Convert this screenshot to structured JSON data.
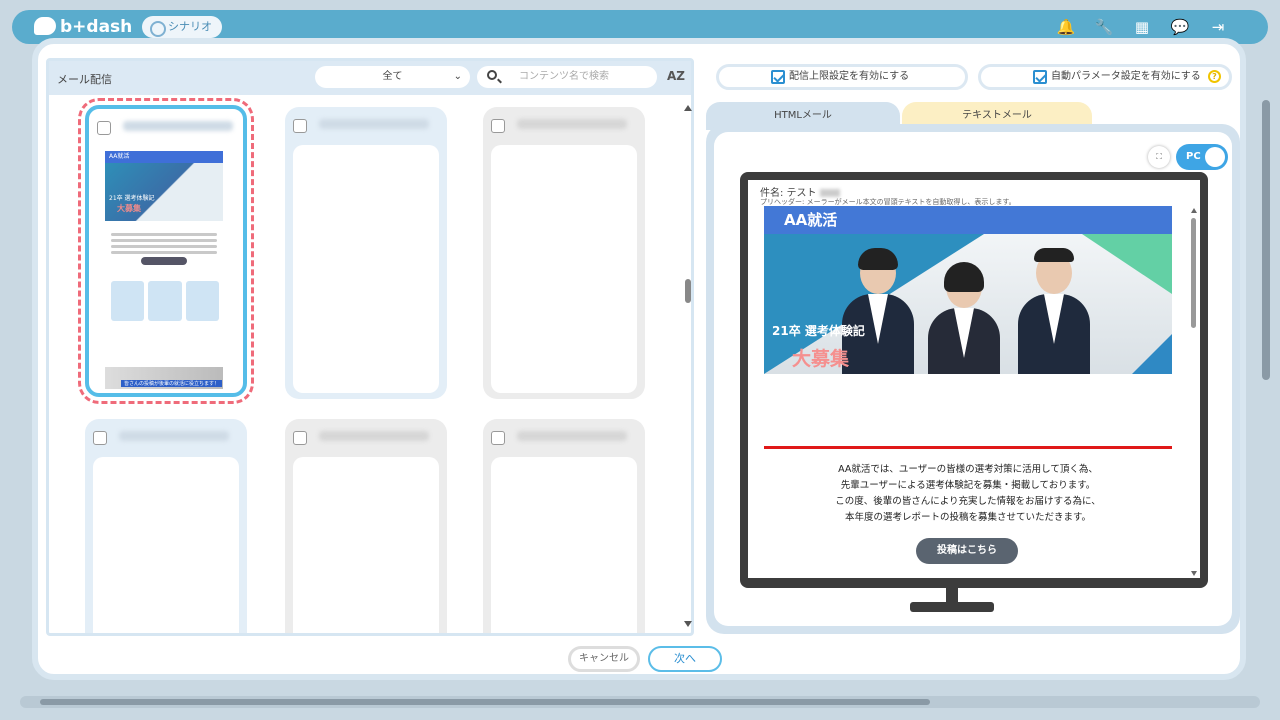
{
  "app": {
    "logo": "b+dash",
    "scenario_chip": "シナリオ",
    "header_icons": [
      "bell-icon",
      "wrench-icon",
      "grid-icon",
      "chat-icon",
      "logout-icon"
    ]
  },
  "left": {
    "title": "メール配信",
    "filter": {
      "selected": "全て"
    },
    "search": {
      "placeholder": "コンテンツ名で検索"
    },
    "sort_label": "AZ"
  },
  "thumb": {
    "header": "AA就活",
    "hero_line1": "21卒 選考体験記",
    "hero_line2": "大募集",
    "banner": "皆さんの投稿が後輩の就活に役立ちます！"
  },
  "options": {
    "limit_label": "配信上限設定を有効にする",
    "auto_param_label": "自動パラメータ設定を有効にする",
    "help_symbol": "?"
  },
  "tabs": {
    "html": "HTMLメール",
    "text": "テキストメール"
  },
  "preview": {
    "expand_symbol": "⛶",
    "device_toggle": "PC",
    "subject_label": "件名: テスト",
    "preheader": "プリヘッダー: メーラーがメール本文の冒頭テキストを自動取得し、表示します。",
    "mail_header": "AA就活",
    "hero_line1": "21卒 選考体験記",
    "hero_line2": "大募集",
    "body_lines": [
      "AA就活では、ユーザーの皆様の選考対策に活用して頂く為、",
      "先輩ユーザーによる選考体験記を募集・掲載しております。",
      "この度、後輩の皆さんにより充実した情報をお届けする為に、",
      "本年度の選考レポートの投稿を募集させていただきます。"
    ],
    "cta_label": "投稿はこちら"
  },
  "footer": {
    "cancel_label": "キャンセル",
    "next_label": "次へ"
  }
}
